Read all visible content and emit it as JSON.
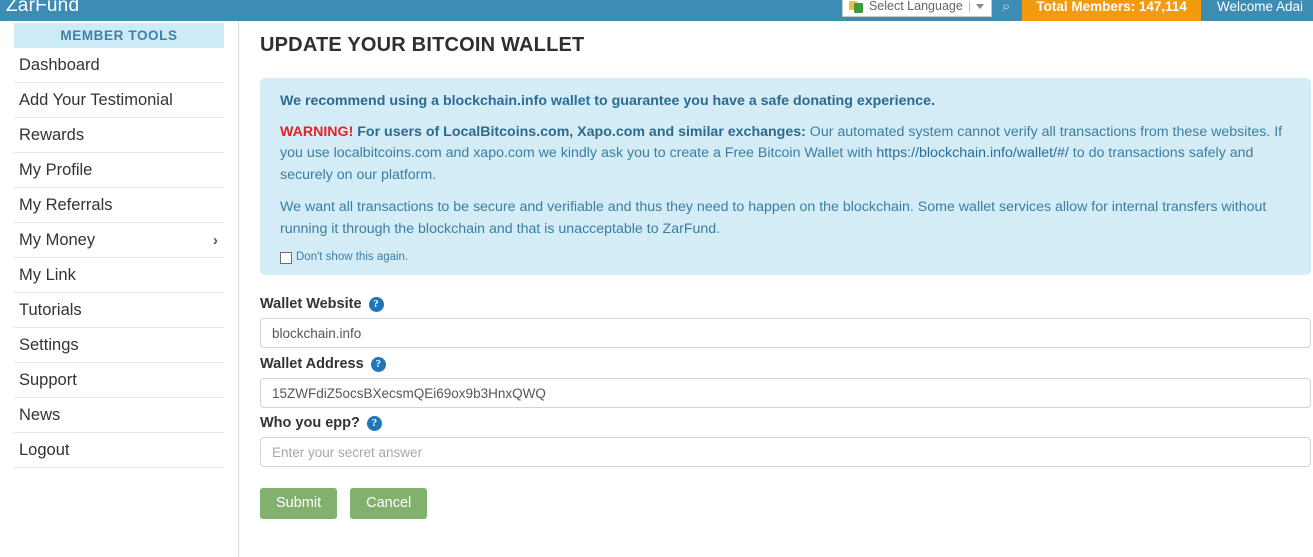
{
  "topbar": {
    "brand": "ZarFund",
    "language_widget": {
      "icon": "google-translate-icon",
      "label": "Select Language",
      "separator": "|",
      "caret": "chevron-down-icon"
    },
    "bell_icon": "⌕",
    "members_badge": "Total Members: 147,114",
    "welcome": "Welcome Adai"
  },
  "sidebar": {
    "heading": "MEMBER TOOLS",
    "items": [
      {
        "label": "Dashboard",
        "chevron": ""
      },
      {
        "label": "Add Your Testimonial",
        "chevron": ""
      },
      {
        "label": "Rewards",
        "chevron": ""
      },
      {
        "label": "My Profile",
        "chevron": ""
      },
      {
        "label": "My Referrals",
        "chevron": ""
      },
      {
        "label": "My Money",
        "chevron": "›"
      },
      {
        "label": "My Link",
        "chevron": ""
      },
      {
        "label": "Tutorials",
        "chevron": ""
      },
      {
        "label": "Settings",
        "chevron": ""
      },
      {
        "label": "Support",
        "chevron": ""
      },
      {
        "label": "News",
        "chevron": ""
      },
      {
        "label": "Logout",
        "chevron": ""
      }
    ]
  },
  "main": {
    "page_title": "UPDATE YOUR BITCOIN WALLET",
    "alert": {
      "lead_before": "We recommend using a ",
      "lead_link": "blockchain.info wallet",
      "lead_after": " to guarantee you have a safe donating experience.",
      "warning_word": "WARNING!",
      "warning_bold": " For users of LocalBitcoins.com, Xapo.com and similar exchanges:",
      "warning_rest": " Our automated system cannot verify all transactions from these websites. If you use localbitcoins.com and xapo.com we kindly ask you to create a Free Bitcoin Wallet with ",
      "warning_link": "https://blockchain.info/wallet/#/",
      "warning_tail": " to do transactions safely and securely on our platform.",
      "paragraph3": "We want all transactions to be secure and verifiable and thus they need to happen on the blockchain. Some wallet services allow for internal transfers without running it through the blockchain and that is unacceptable to ZarFund.",
      "checkbox_label": "Don't show this again."
    },
    "form": {
      "wallet_website": {
        "label": "Wallet Website",
        "help": "?",
        "value": "blockchain.info"
      },
      "wallet_address": {
        "label": "Wallet Address",
        "help": "?",
        "value": "15ZWFdiZ5ocsBXecsmQEi69ox9b3HnxQWQ"
      },
      "secret_question": {
        "label": "Who you epp?",
        "help": "?",
        "value": "",
        "placeholder": "Enter your secret answer"
      },
      "submit_label": "Submit",
      "cancel_label": "Cancel"
    }
  },
  "colors": {
    "header_blue": "#3d8cb3",
    "badge_orange": "#f49b0d",
    "alert_bg": "#d4ecf5",
    "alert_text": "#2b6a8f",
    "warning_red": "#e8202a",
    "button_green": "#82b06e",
    "member_tools_bg": "#cdeaf7"
  }
}
